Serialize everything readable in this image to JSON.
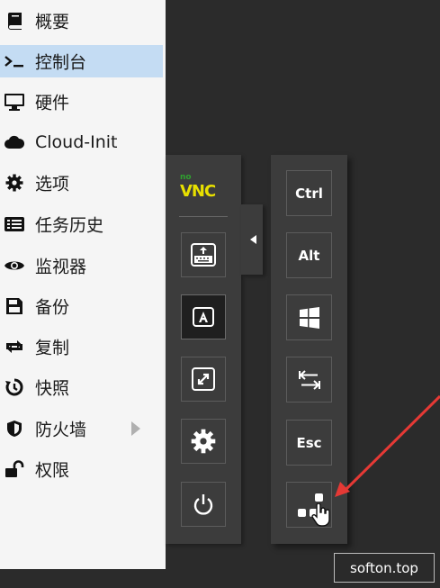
{
  "sidebar": {
    "items": [
      {
        "label": "概要",
        "icon": "book-icon"
      },
      {
        "label": "控制台",
        "icon": "terminal-icon",
        "active": true
      },
      {
        "label": "硬件",
        "icon": "monitor-icon"
      },
      {
        "label": "Cloud-Init",
        "icon": "cloud-icon"
      },
      {
        "label": "选项",
        "icon": "gear-icon"
      },
      {
        "label": "任务历史",
        "icon": "list-icon"
      },
      {
        "label": "监视器",
        "icon": "eye-icon"
      },
      {
        "label": "备份",
        "icon": "floppy-icon"
      },
      {
        "label": "复制",
        "icon": "retweet-icon"
      },
      {
        "label": "快照",
        "icon": "history-icon"
      },
      {
        "label": "防火墙",
        "icon": "shield-icon",
        "has_submenu": true
      },
      {
        "label": "权限",
        "icon": "unlock-icon"
      }
    ]
  },
  "novnc": {
    "logo_top": "no",
    "logo_bottom": "VNC",
    "left_buttons": [
      "keyboard-icon",
      "keyboard-a-icon",
      "fullscreen-icon",
      "settings-gear-icon",
      "power-icon"
    ],
    "right_buttons": {
      "ctrl": "Ctrl",
      "alt": "Alt",
      "esc": "Esc"
    }
  },
  "watermark": "softon.top",
  "colors": {
    "sidebar_bg": "#f5f5f5",
    "active_bg": "#c4dcf3",
    "console_bg": "#2b2b2b",
    "panel_bg": "#3c3c3c",
    "arrow": "#e53935"
  }
}
